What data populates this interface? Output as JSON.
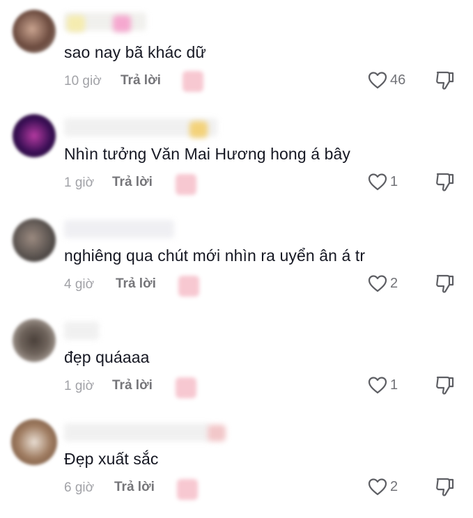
{
  "reply_label": "Trả lời",
  "colors": {
    "text": "#161823",
    "meta": "#a1a2a7",
    "icon": "#5d5e63"
  },
  "icons": {
    "like": "heart-icon",
    "dislike": "thumbs-down-icon"
  },
  "comments": [
    {
      "text": "sao nay bã khác dữ",
      "time": "10 giờ",
      "likes": "46"
    },
    {
      "text": "Nhìn tưởng Văn Mai Hương hong á bây",
      "time": "1 giờ",
      "likes": "1"
    },
    {
      "text": "nghiêng qua chút mới nhìn ra uyển ân á tr",
      "time": "4 giờ",
      "likes": "2"
    },
    {
      "text": "đẹp quáaaa",
      "time": "1 giờ",
      "likes": "1"
    },
    {
      "text": "Đẹp xuất sắc",
      "time": "6 giờ",
      "likes": "2"
    }
  ]
}
